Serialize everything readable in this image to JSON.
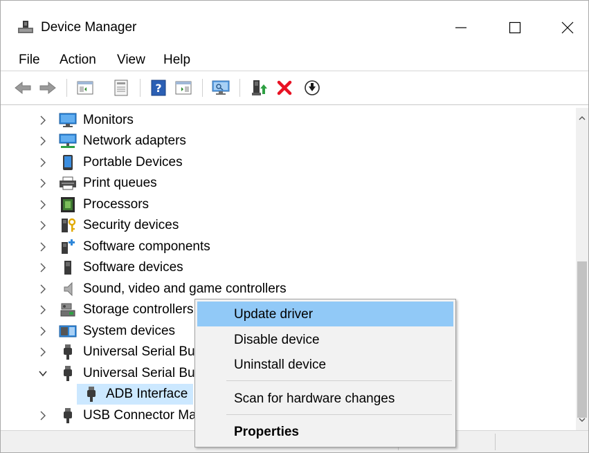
{
  "window": {
    "title": "Device Manager"
  },
  "menu": [
    "File",
    "Action",
    "View",
    "Help"
  ],
  "toolbar": {
    "buttons": [
      "back-icon",
      "forward-icon",
      "show-hide-console-tree-icon",
      "properties-icon",
      "help-icon",
      "show-action-pane-icon",
      "scan-hardware-icon",
      "update-driver-icon",
      "uninstall-icon",
      "disable-icon"
    ]
  },
  "tree": {
    "items": [
      {
        "label": "Monitors",
        "icon": "monitor-icon",
        "expanded": false
      },
      {
        "label": "Network adapters",
        "icon": "network-adapter-icon",
        "expanded": false
      },
      {
        "label": "Portable Devices",
        "icon": "portable-device-icon",
        "expanded": false
      },
      {
        "label": "Print queues",
        "icon": "printer-icon",
        "expanded": false
      },
      {
        "label": "Processors",
        "icon": "processor-icon",
        "expanded": false
      },
      {
        "label": "Security devices",
        "icon": "security-device-icon",
        "expanded": false
      },
      {
        "label": "Software components",
        "icon": "software-component-icon",
        "expanded": false
      },
      {
        "label": "Software devices",
        "icon": "software-device-icon",
        "expanded": false
      },
      {
        "label": "Sound, video and game controllers",
        "icon": "speaker-icon",
        "expanded": false
      },
      {
        "label": "Storage controllers",
        "icon": "storage-controller-icon",
        "expanded": false
      },
      {
        "label": "System devices",
        "icon": "system-device-icon",
        "expanded": false
      },
      {
        "label": "Universal Serial Bu",
        "icon": "usb-icon",
        "expanded": false
      },
      {
        "label": "Universal Serial Bu",
        "icon": "usb-icon",
        "expanded": true
      },
      {
        "label": "ADB Interface",
        "icon": "usb-icon",
        "child": true,
        "selected": true
      },
      {
        "label": "USB Connector Ma",
        "icon": "usb-icon",
        "expanded": false
      }
    ]
  },
  "context_menu": {
    "items": [
      {
        "label": "Update driver",
        "highlighted": true
      },
      {
        "label": "Disable device"
      },
      {
        "label": "Uninstall device"
      },
      {
        "label": "Scan for hardware changes"
      },
      {
        "label": "Properties",
        "bold": true
      }
    ]
  },
  "colors": {
    "selection": "#cce8ff",
    "menu_highlight": "#91c9f7",
    "uninstall_red": "#e81123",
    "accent_blue": "#1e78d7"
  }
}
